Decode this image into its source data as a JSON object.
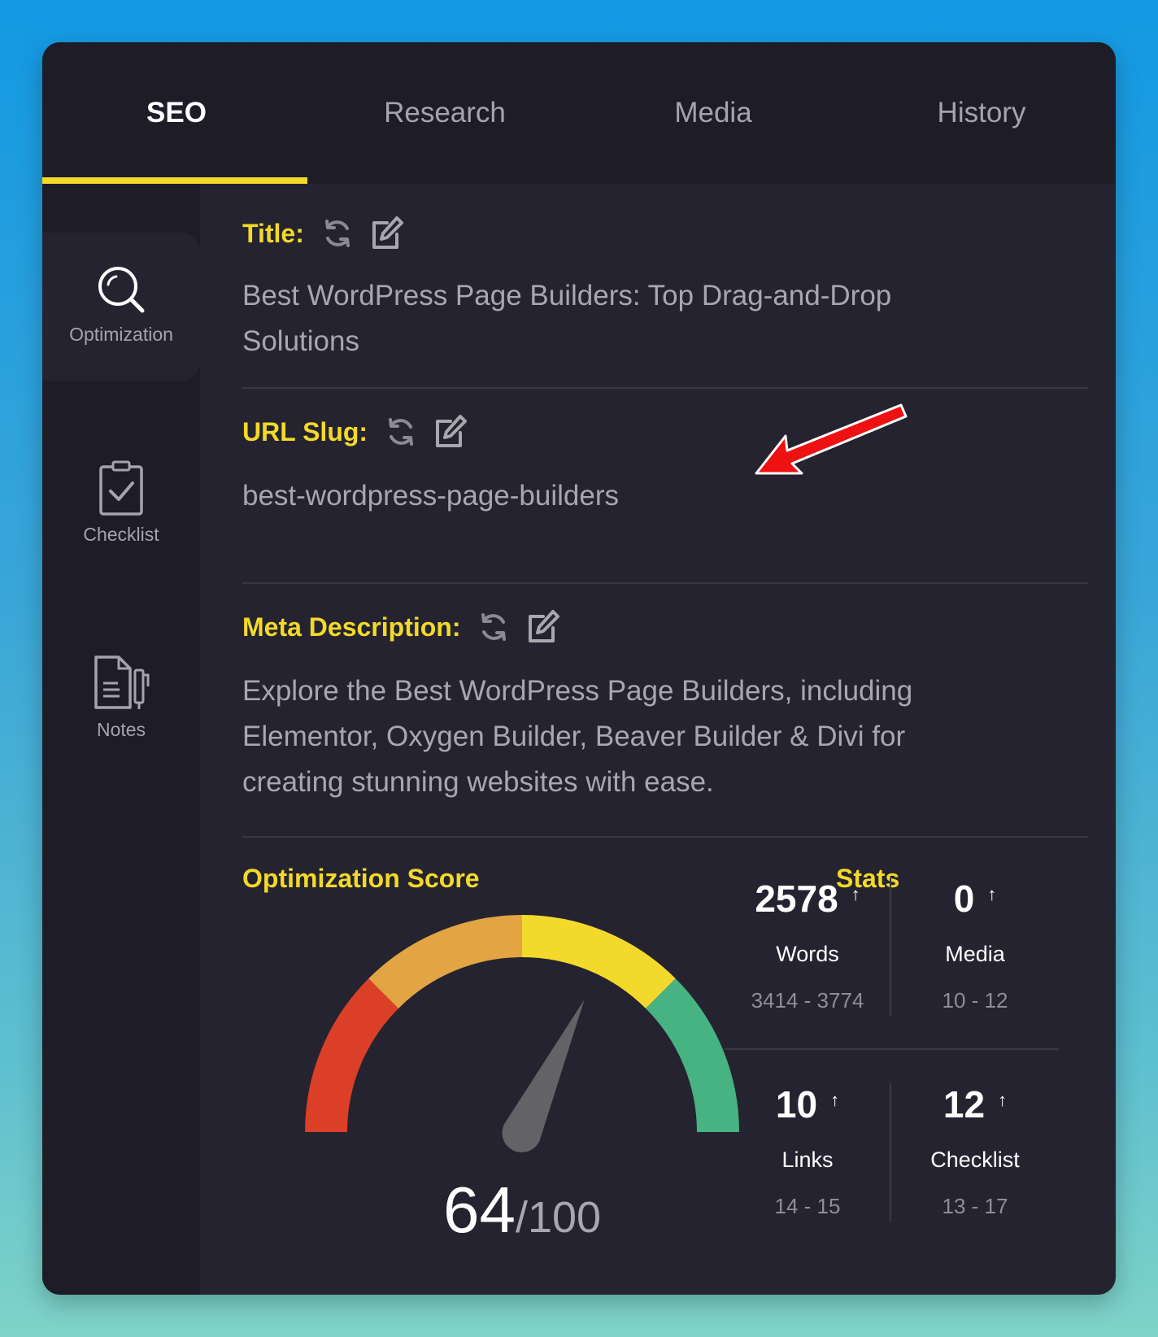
{
  "tabs": [
    {
      "label": "SEO",
      "active": true
    },
    {
      "label": "Research",
      "active": false
    },
    {
      "label": "Media",
      "active": false
    },
    {
      "label": "History",
      "active": false
    }
  ],
  "sidebar": {
    "items": [
      {
        "label": "Optimization",
        "icon": "search-icon",
        "active": true
      },
      {
        "label": "Checklist",
        "icon": "clipboard-check-icon",
        "active": false
      },
      {
        "label": "Notes",
        "icon": "notes-icon",
        "active": false
      }
    ]
  },
  "fields": {
    "title": {
      "label": "Title:",
      "value": "Best WordPress Page Builders: Top Drag-and-Drop Solutions"
    },
    "slug": {
      "label": "URL Slug:",
      "value": "best-wordpress-page-builders"
    },
    "meta": {
      "label": "Meta Description:",
      "value": "Explore the Best WordPress Page Builders, including Elementor, Oxygen Builder, Beaver Builder & Divi for creating stunning websites with ease."
    }
  },
  "score": {
    "title": "Optimization Score",
    "value": "64",
    "max": "/100",
    "fraction": 0.64
  },
  "stats": {
    "title": "Stats",
    "items": [
      {
        "value": "2578",
        "label": "Words",
        "range": "3414 - 3774"
      },
      {
        "value": "0",
        "label": "Media",
        "range": "10 - 12"
      },
      {
        "value": "10",
        "label": "Links",
        "range": "14 - 15"
      },
      {
        "value": "12",
        "label": "Checklist",
        "range": "13 - 17"
      }
    ]
  },
  "colors": {
    "accent": "#f2d92a",
    "gauge_red": "#dc3f28",
    "gauge_orange": "#e3a443",
    "gauge_yellow": "#f3d92c",
    "gauge_green": "#47b282",
    "annotation_arrow": "#ee1111"
  }
}
